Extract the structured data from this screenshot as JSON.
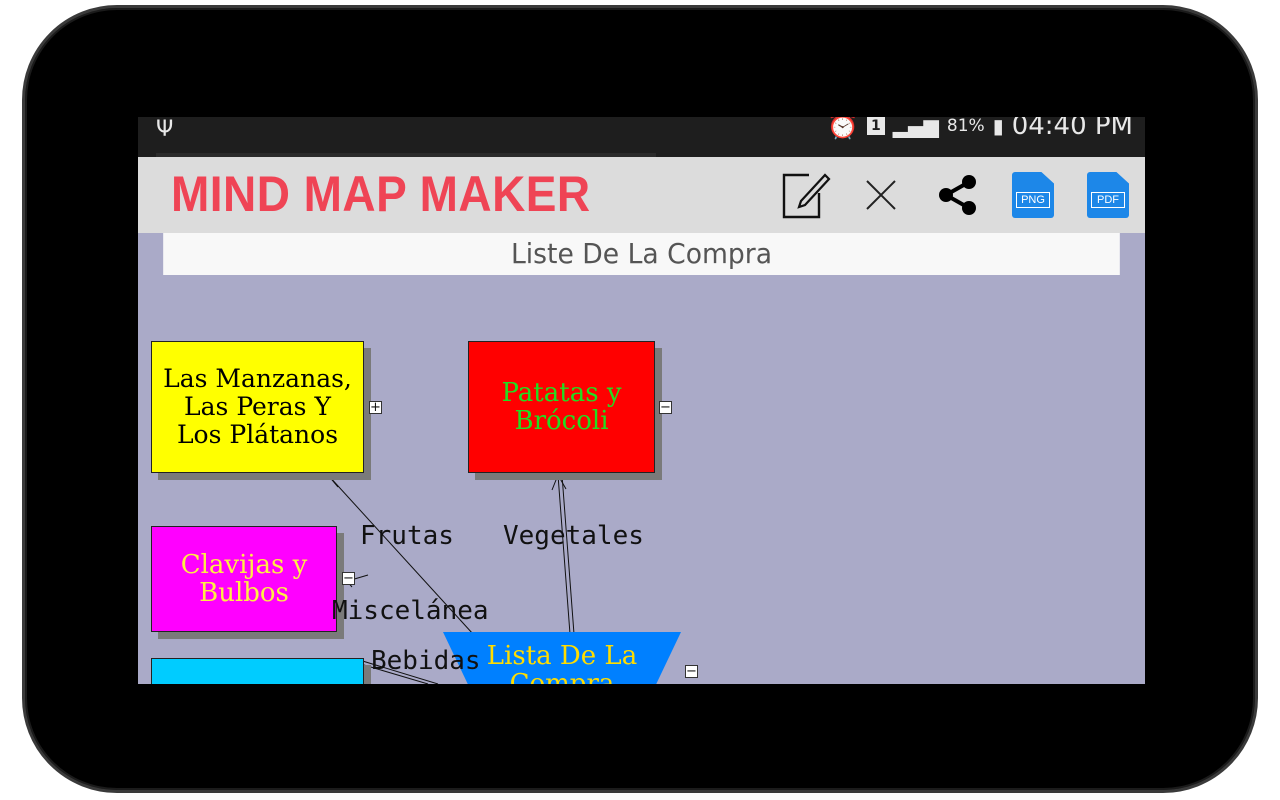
{
  "status_bar": {
    "usb_icon": "usb-icon",
    "battery_percent": "81%",
    "time": "04:40 PM",
    "sim_slot": "1"
  },
  "app": {
    "title": "MIND MAP MAKER",
    "colors": {
      "title": "#ef4455",
      "appbar": "#dcdcdc",
      "canvas": "#aaaac8",
      "file_icon": "#1d87e8"
    },
    "toolbar": {
      "edit_icon": "edit-icon",
      "close_icon": "close-icon",
      "share_icon": "share-icon",
      "png_label": "PNG",
      "pdf_label": "PDF"
    }
  },
  "document": {
    "title": "Liste De La Compra"
  },
  "mindmap": {
    "nodes": {
      "fruit": {
        "text": "Las Manzanas, Las Peras Y Los Plátanos",
        "bg": "#ffff00",
        "color": "#000000",
        "toggle": "+"
      },
      "veg": {
        "text": "Patatas y Brócoli",
        "bg": "#ff0000",
        "color": "#22dd22",
        "toggle": "−"
      },
      "misc": {
        "text": "Clavijas y Bulbos",
        "bg": "#ff00ff",
        "color": "#ffee44",
        "toggle": "−"
      },
      "drinks": {
        "text": "",
        "bg": "#00ccff"
      },
      "root": {
        "text": "Lista De La Compra",
        "bg": "#0080ff",
        "color": "#ffdd00",
        "toggle": "−"
      }
    },
    "edge_labels": {
      "frutas": "Frutas",
      "vegetales": "Vegetales",
      "miscelanea": "Miscelánea",
      "bebidas": "Bebidas"
    }
  }
}
